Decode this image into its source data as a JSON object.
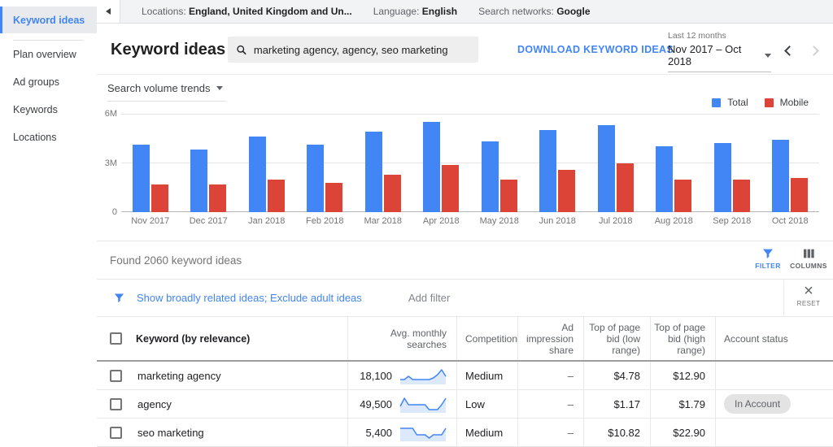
{
  "topbar": {
    "items": [
      {
        "label": "Locations:",
        "value": "England, United Kingdom and Un..."
      },
      {
        "label": "Language:",
        "value": "English"
      },
      {
        "label": "Search networks:",
        "value": "Google"
      }
    ]
  },
  "sidebar": {
    "active_label": "Keyword ideas",
    "items": [
      {
        "label": "Plan overview"
      },
      {
        "label": "Ad groups"
      },
      {
        "label": "Keywords"
      },
      {
        "label": "Locations"
      }
    ]
  },
  "header": {
    "title": "Keyword ideas",
    "search_value": "marketing agency, agency, seo marketing",
    "download_label": "DOWNLOAD KEYWORD IDEAS",
    "range_label": "Last 12 months",
    "range_value": "Nov 2017 – Oct 2018"
  },
  "chart_data": {
    "type": "bar",
    "title": "Search volume trends",
    "categories": [
      "Nov 2017",
      "Dec 2017",
      "Jan 2018",
      "Feb 2018",
      "Mar 2018",
      "Apr 2018",
      "May 2018",
      "Jun 2018",
      "Jul 2018",
      "Aug 2018",
      "Sep 2018",
      "Oct 2018"
    ],
    "series": [
      {
        "name": "Total",
        "color": "#4285f4",
        "values": [
          4.1,
          3.8,
          4.6,
          4.1,
          4.9,
          5.5,
          4.3,
          5.0,
          5.3,
          4.0,
          4.2,
          4.4
        ]
      },
      {
        "name": "Mobile",
        "color": "#db4437",
        "values": [
          1.7,
          1.7,
          2.0,
          1.8,
          2.3,
          2.9,
          2.0,
          2.6,
          3.0,
          2.0,
          2.0,
          2.1
        ]
      }
    ],
    "ylim": [
      0,
      6
    ],
    "yticks": [
      "6M",
      "3M",
      "0"
    ],
    "unit": "M searches",
    "grid": true,
    "legend_position": "top-right"
  },
  "results": {
    "found_text": "Found 2060 keyword ideas",
    "filter_label": "FILTER",
    "columns_label": "COLUMNS"
  },
  "filterbar": {
    "filters_text": "Show broadly related ideas; Exclude adult ideas",
    "add_filter_label": "Add filter",
    "reset_label": "RESET"
  },
  "table": {
    "headers": [
      "Keyword (by relevance)",
      "Avg. monthly searches",
      "Competition",
      "Ad impression share",
      "Top of page bid (low range)",
      "Top of page bid (high range)",
      "Account status"
    ],
    "rows": [
      {
        "keyword": "marketing agency",
        "avg_monthly_searches": "18,100",
        "sparkline": [
          3,
          3,
          5,
          3,
          3,
          3,
          3,
          3,
          4,
          6,
          9,
          5
        ],
        "competition": "Medium",
        "ad_impression_share": "–",
        "top_of_page_bid_low": "$4.78",
        "top_of_page_bid_high": "$12.90",
        "account_status": ""
      },
      {
        "keyword": "agency",
        "avg_monthly_searches": "49,500",
        "sparkline": [
          4,
          9,
          5,
          5,
          5,
          5,
          5,
          2,
          2,
          2,
          5,
          9
        ],
        "competition": "Low",
        "ad_impression_share": "–",
        "top_of_page_bid_low": "$1.17",
        "top_of_page_bid_high": "$1.79",
        "account_status": "In Account"
      },
      {
        "keyword": "seo marketing",
        "avg_monthly_searches": "5,400",
        "sparkline": [
          8,
          8,
          8,
          8,
          4,
          4,
          4,
          2,
          4,
          4,
          4,
          8
        ],
        "competition": "Medium",
        "ad_impression_share": "–",
        "top_of_page_bid_low": "$10.82",
        "top_of_page_bid_high": "$22.90",
        "account_status": ""
      }
    ]
  }
}
